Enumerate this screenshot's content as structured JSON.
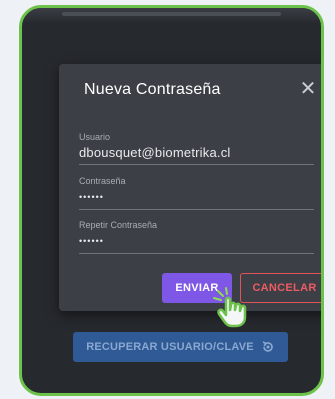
{
  "dialog": {
    "title": "Nueva Contraseña",
    "close_icon": "close-icon"
  },
  "form": {
    "usuario_label": "Usuario",
    "usuario_value": "dbousquet@biometrika.cl",
    "password_label": "Contraseña",
    "password_value": "••••••",
    "repeat_label": "Repetir Contraseña",
    "repeat_value": "••••••"
  },
  "buttons": {
    "send_label": "ENVIAR",
    "cancel_label": "CANCELAR",
    "recover_label": "RECUPERAR USUARIO/CLAVE",
    "recover_icon": "rotate-arrow-icon"
  },
  "colors": {
    "frame": "#6cc24a",
    "send": "#7e57e6",
    "cancel": "#ef5b62",
    "recover": "#2f5a95"
  }
}
